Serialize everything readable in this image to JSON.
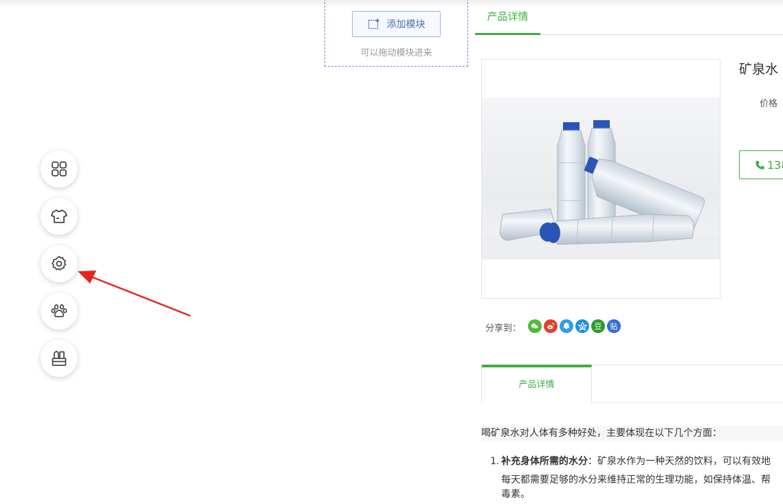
{
  "module": {
    "add_button_label": "添加模块",
    "hint": "可以拖动模块进来"
  },
  "sidebar": {
    "buttons": [
      {
        "icon": "grid-icon"
      },
      {
        "icon": "tshirt-icon"
      },
      {
        "icon": "gear-icon"
      },
      {
        "icon": "paw-icon"
      },
      {
        "icon": "stationery-icon"
      }
    ]
  },
  "annotation": {
    "color": "#e8231f"
  },
  "top_tab": {
    "label": "产品详情"
  },
  "product": {
    "name": "矿泉水",
    "price_label": "价格",
    "phone": "138"
  },
  "share": {
    "label": "分享到：",
    "icons": [
      {
        "name": "wechat-icon",
        "glyph": "",
        "color": "#4dbb3a"
      },
      {
        "name": "weibo-icon",
        "glyph": "",
        "color": "#e6402b"
      },
      {
        "name": "qq-icon",
        "glyph": "",
        "color": "#2aa0e6"
      },
      {
        "name": "qzone-icon",
        "glyph": "",
        "color": "#1f8fe0"
      },
      {
        "name": "douban-icon",
        "glyph": "豆",
        "color": "#2b9c2b"
      },
      {
        "name": "tieba-icon",
        "glyph": "贴",
        "color": "#2e6fd4"
      }
    ]
  },
  "detail_tab": {
    "label": "产品详情"
  },
  "article": {
    "intro": "喝矿泉水对人体有多种好处，主要体现在以下几个方面：",
    "item1_number": "1.",
    "item1_title": "补充身体所需的水分",
    "item1_text": "：矿泉水作为一种天然的饮料，可以有效地",
    "item1_line2": "每天都需要足够的水分来维持正常的生理功能，如保持体温、帮",
    "item1_line3": "毒素。"
  },
  "colors": {
    "accent": "#3fae3f",
    "module_border": "#6a8dc8"
  }
}
